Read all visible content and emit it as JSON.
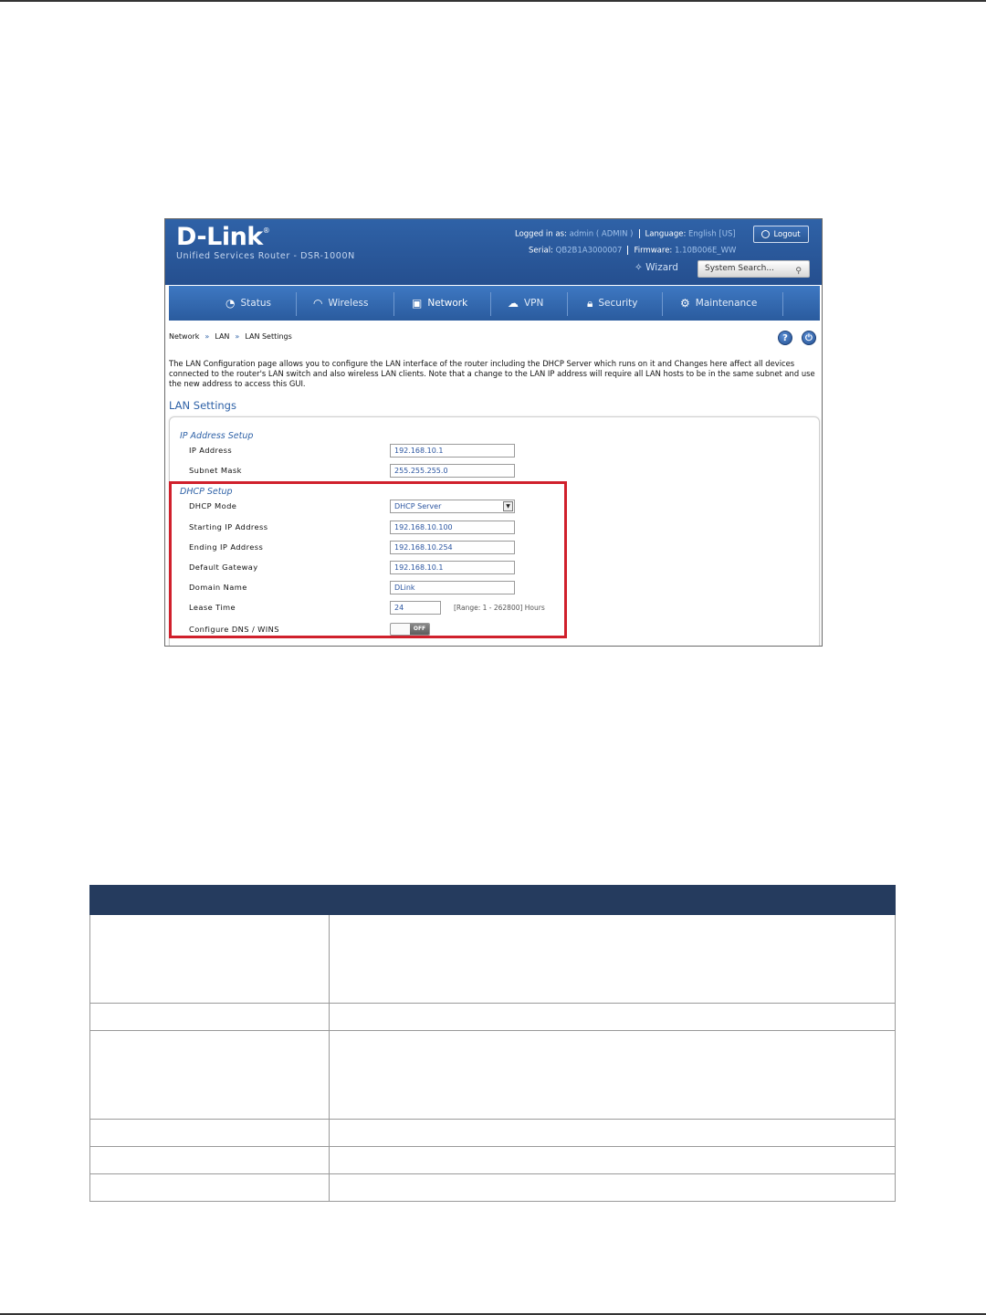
{
  "router_ui": {
    "logo": "D-Link",
    "logo_reg": "®",
    "product_name": "Unified Services Router - DSR-1000N",
    "header": {
      "logged_in_label": "Logged in as:",
      "logged_in_value": "admin ( ADMIN )",
      "language_label": "Language:",
      "language_value": "English [US]",
      "serial_label": "Serial:",
      "serial_value": "QB2B1A3000007",
      "firmware_label": "Firmware:",
      "firmware_value": "1.10B006E_WW",
      "logout_label": "Logout",
      "wizard_label": "Wizard",
      "search_placeholder": "System Search..."
    },
    "nav": {
      "status": "Status",
      "wireless": "Wireless",
      "network": "Network",
      "vpn": "VPN",
      "security": "Security",
      "maintenance": "Maintenance"
    },
    "breadcrumb": {
      "network": "Network",
      "lan": "LAN",
      "lan_settings": "LAN Settings",
      "arrow": "»"
    },
    "intro_text": "The LAN Configuration page allows you to configure the LAN interface of the router including the DHCP Server which runs on it and Changes here affect all devices connected to the router's LAN switch and also wireless LAN clients. Note that a change to the LAN IP address will require all LAN hosts to be in the same subnet and use the new address to access this GUI.",
    "section_title": "LAN Settings",
    "ip_setup": {
      "title": "IP Address Setup",
      "ip_address_label": "IP Address",
      "ip_address_value": "192.168.10.1",
      "subnet_mask_label": "Subnet Mask",
      "subnet_mask_value": "255.255.255.0"
    },
    "dhcp_setup": {
      "title": "DHCP Setup",
      "mode_label": "DHCP Mode",
      "mode_value": "DHCP Server",
      "start_ip_label": "Starting IP Address",
      "start_ip_value": "192.168.10.100",
      "end_ip_label": "Ending IP Address",
      "end_ip_value": "192.168.10.254",
      "gateway_label": "Default Gateway",
      "gateway_value": "192.168.10.1",
      "domain_label": "Domain Name",
      "domain_value": "DLink",
      "lease_label": "Lease Time",
      "lease_value": "24",
      "lease_note": "[Range: 1 - 262800] Hours",
      "dns_wins_label": "Configure DNS / WINS",
      "dns_wins_toggle": "OFF"
    },
    "icons": {
      "help": "?",
      "logout": "⏻"
    }
  },
  "table": {
    "header": [
      "",
      ""
    ],
    "rows": 6
  },
  "colors": {
    "header_blue": "#2f62a7",
    "nav_blue": "#3e78c2",
    "highlight_red": "#d0202c",
    "table_header": "#253b5e"
  }
}
